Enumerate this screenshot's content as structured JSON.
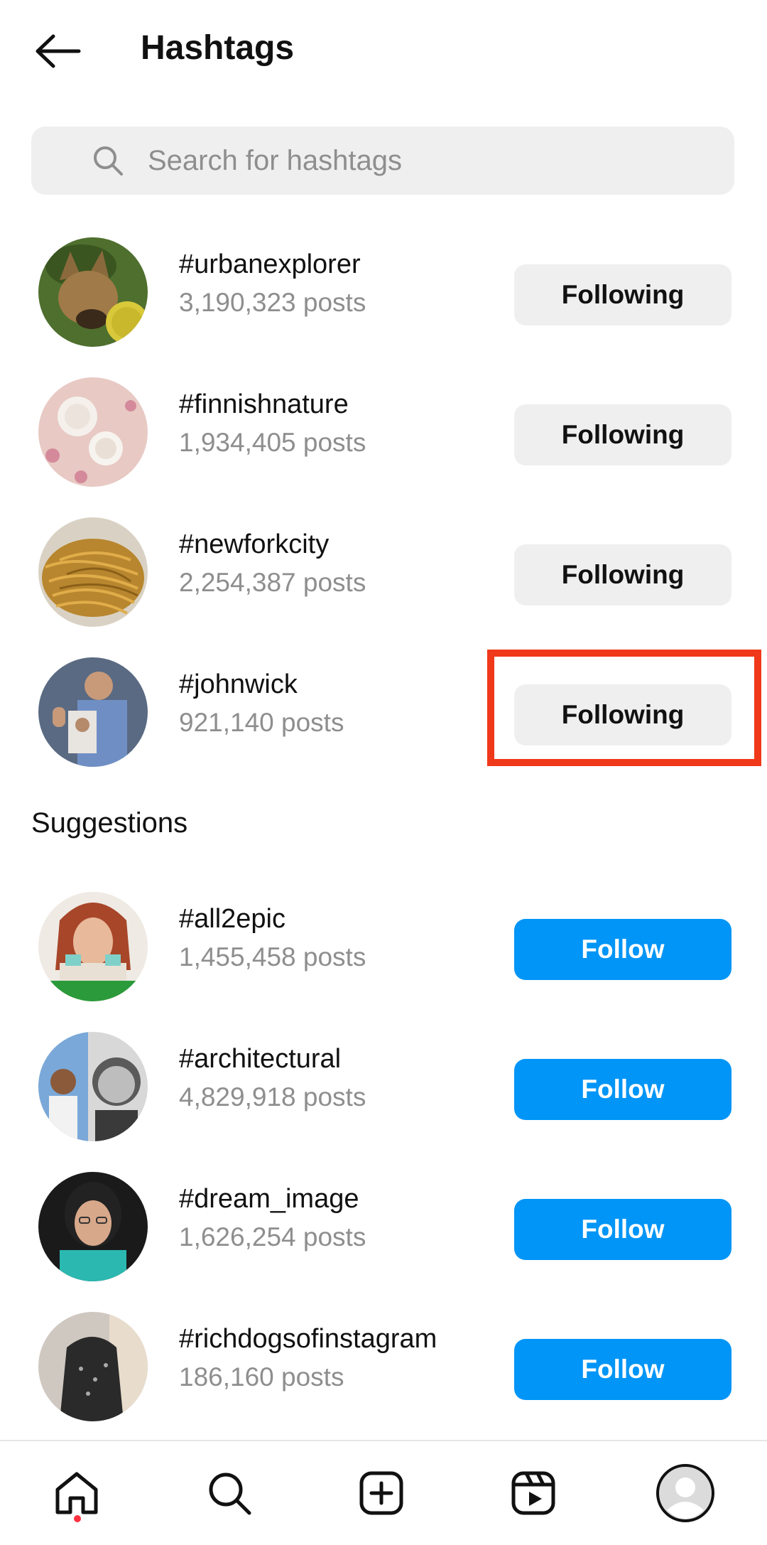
{
  "header": {
    "title": "Hashtags",
    "back_icon": "arrow-left-icon"
  },
  "search": {
    "placeholder": "Search for hashtags",
    "icon": "search-icon"
  },
  "following": [
    {
      "tag": "#urbanexplorer",
      "posts": "3,190,323 posts",
      "button": "Following"
    },
    {
      "tag": "#finnishnature",
      "posts": "1,934,405 posts",
      "button": "Following"
    },
    {
      "tag": "#newforkcity",
      "posts": "2,254,387 posts",
      "button": "Following"
    },
    {
      "tag": "#johnwick",
      "posts": "921,140 posts",
      "button": "Following"
    }
  ],
  "suggestions_title": "Suggestions",
  "suggestions": [
    {
      "tag": "#all2epic",
      "posts": "1,455,458 posts",
      "button": "Follow"
    },
    {
      "tag": "#architectural",
      "posts": "4,829,918 posts",
      "button": "Follow"
    },
    {
      "tag": "#dream_image",
      "posts": "1,626,254 posts",
      "button": "Follow"
    },
    {
      "tag": "#richdogsofinstagram",
      "posts": "186,160 posts",
      "button": "Follow"
    }
  ],
  "nav": {
    "items": [
      "home-icon",
      "search-icon",
      "create-icon",
      "reels-icon",
      "profile-icon"
    ],
    "active": "home-icon",
    "notification_color": "#ff3040"
  },
  "colors": {
    "follow_blue": "#0095f6",
    "following_gray": "#efefef",
    "highlight_red": "#f0381a",
    "secondary_text": "#8e8e8e"
  }
}
